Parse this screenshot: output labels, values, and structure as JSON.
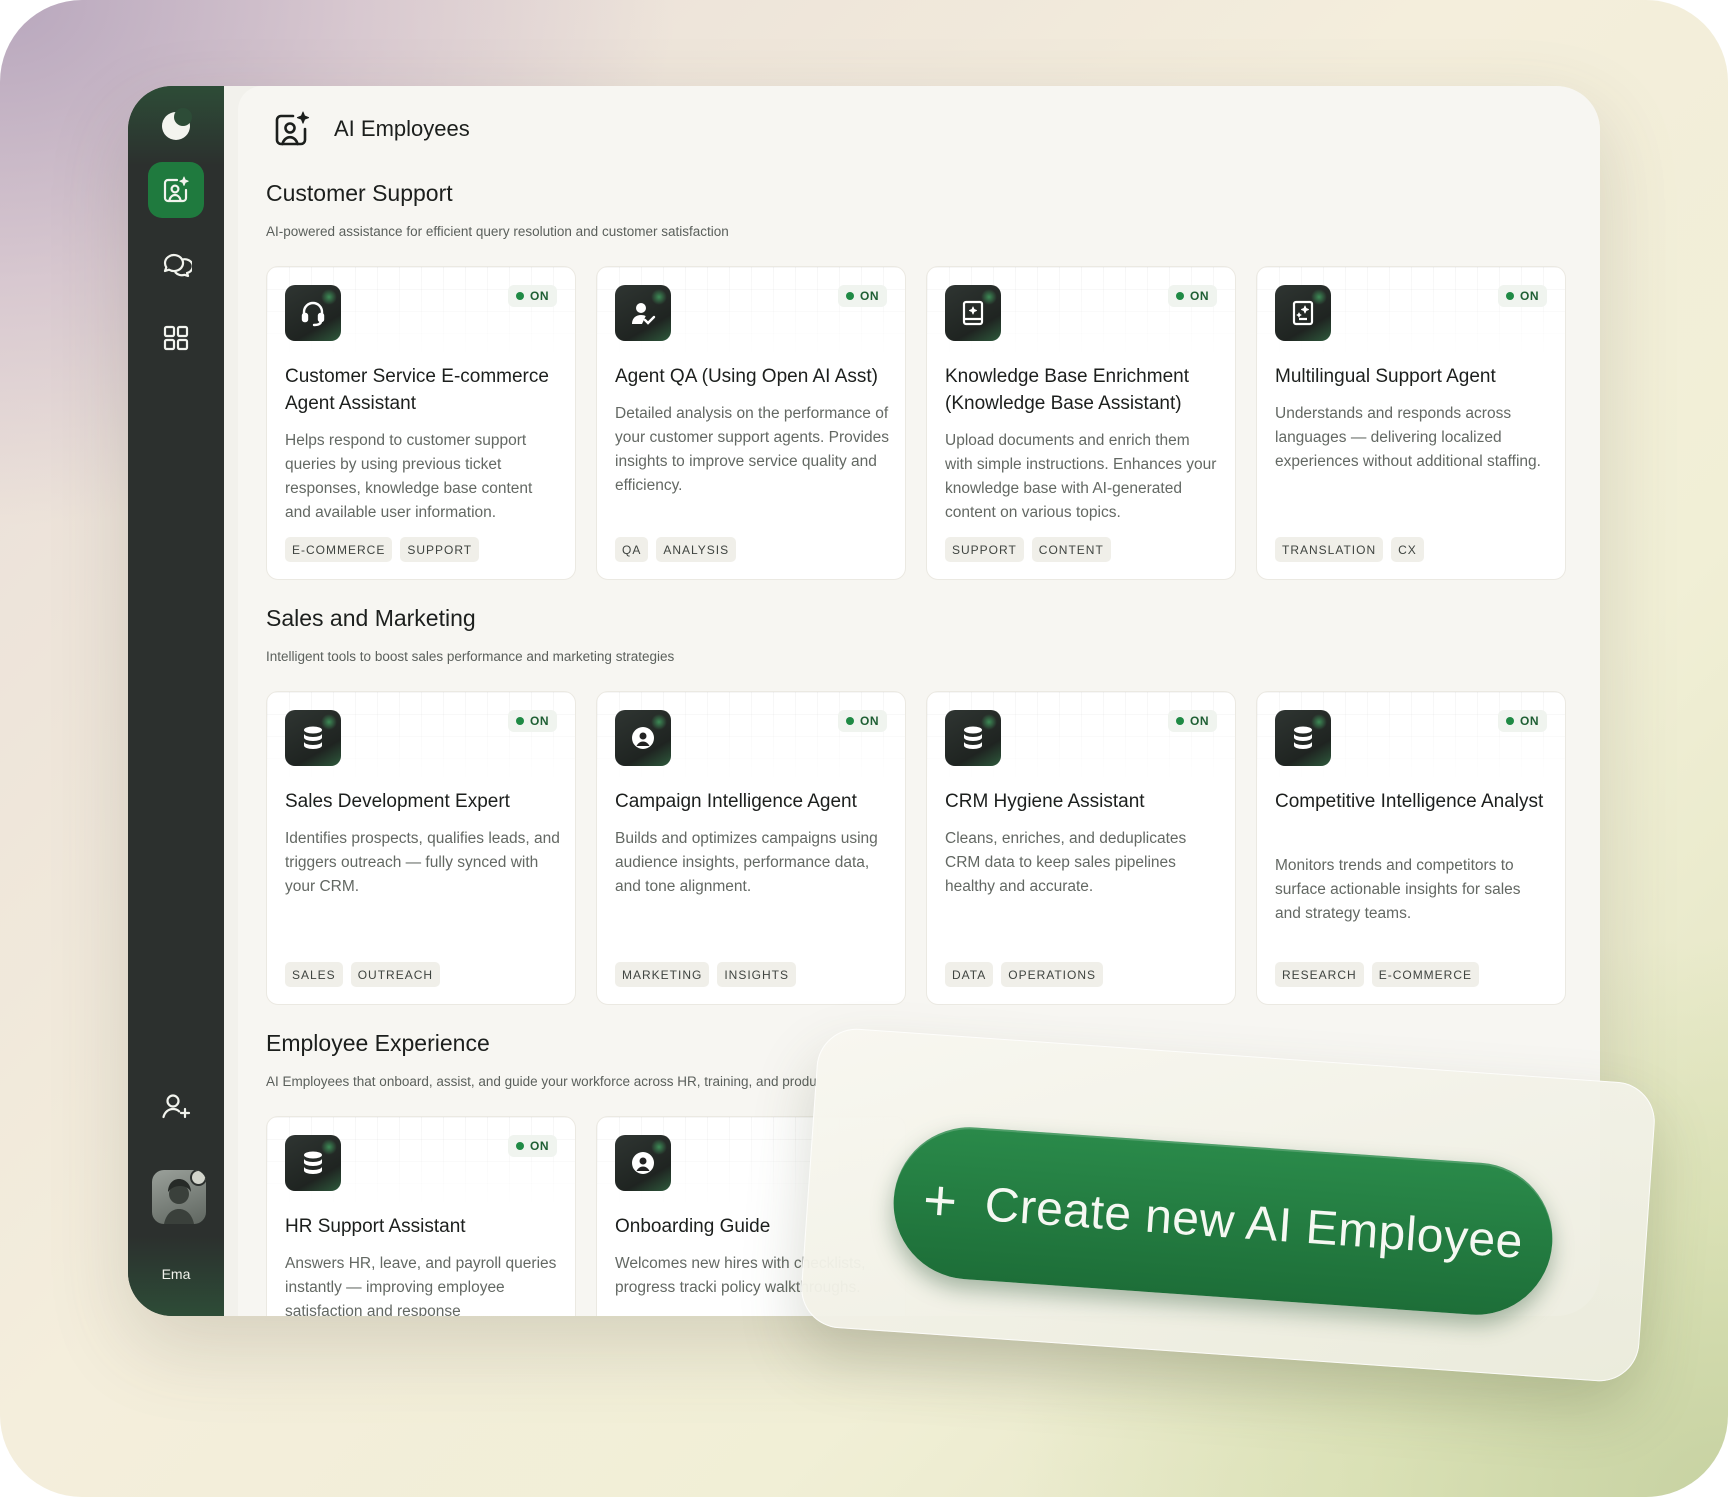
{
  "app": {
    "title": "AI Employees",
    "user_name": "Ema"
  },
  "colors": {
    "accent": "#1f7a3e",
    "sidebar": "#2c302e",
    "on_dot": "#1f8a45"
  },
  "sidebar": {
    "items": [
      {
        "name": "ai-employees",
        "icon": "user-sparkle-icon",
        "active": true
      },
      {
        "name": "chats",
        "icon": "chat-bubbles-icon",
        "active": false
      },
      {
        "name": "apps",
        "icon": "grid-icon",
        "active": false
      },
      {
        "name": "add-user",
        "icon": "user-plus-icon",
        "active": false
      }
    ]
  },
  "sections": [
    {
      "title": "Customer Support",
      "subtitle": "AI-powered assistance for efficient query resolution and customer satisfaction",
      "cards": [
        {
          "title": "Customer Service E-commerce Agent Assistant",
          "status": "ON",
          "icon": "headset-icon",
          "desc": "Helps respond to customer support queries by using previous ticket responses, knowledge base content and available user information.",
          "tags": [
            "E-COMMERCE",
            "SUPPORT"
          ]
        },
        {
          "title": "Agent QA (Using Open AI Asst)",
          "status": "ON",
          "icon": "user-check-icon",
          "desc": "Detailed analysis on the performance of your customer support agents. Provides insights to improve service quality and efficiency.",
          "tags": [
            "QA",
            "ANALYSIS"
          ]
        },
        {
          "title": "Knowledge Base Enrichment (Knowledge Base Assistant)",
          "status": "ON",
          "icon": "book-sparkle-icon",
          "desc": "Upload documents and enrich them with simple instructions. Enhances your knowledge base with AI-generated content on various topics.",
          "tags": [
            "SUPPORT",
            "CONTENT"
          ]
        },
        {
          "title": "Multilingual Support Agent",
          "status": "ON",
          "icon": "document-sparkle-icon",
          "desc": "Understands and responds across languages — delivering localized experiences without additional staffing.",
          "tags": [
            "TRANSLATION",
            "CX"
          ]
        }
      ]
    },
    {
      "title": "Sales and Marketing",
      "subtitle": "Intelligent tools to boost sales performance and marketing strategies",
      "cards": [
        {
          "title": "Sales Development Expert",
          "status": "ON",
          "icon": "database-icon",
          "desc": "Identifies prospects, qualifies leads, and triggers outreach — fully synced with your CRM.",
          "tags": [
            "SALES",
            "OUTREACH"
          ]
        },
        {
          "title": "Campaign Intelligence Agent",
          "status": "ON",
          "icon": "face-sparkle-icon",
          "desc": "Builds and optimizes campaigns using audience insights, performance data, and tone alignment.",
          "tags": [
            "MARKETING",
            "INSIGHTS"
          ]
        },
        {
          "title": "CRM Hygiene Assistant",
          "status": "ON",
          "icon": "database-icon",
          "desc": "Cleans, enriches, and deduplicates CRM data to keep sales pipelines healthy and accurate.",
          "tags": [
            "DATA",
            "OPERATIONS"
          ]
        },
        {
          "title": "Competitive Intelligence Analyst",
          "status": "ON",
          "icon": "database-icon",
          "desc": "Monitors trends and competitors to surface actionable insights for sales and strategy teams.",
          "tags": [
            "RESEARCH",
            "E-COMMERCE"
          ]
        }
      ]
    },
    {
      "title": "Employee Experience",
      "subtitle": "AI Employees that onboard, assist, and guide your workforce across HR, training, and produ",
      "cards": [
        {
          "title": "HR Support Assistant",
          "status": "ON",
          "icon": "database-icon",
          "desc": "Answers HR, leave, and payroll queries instantly — improving employee satisfaction and response",
          "tags": []
        },
        {
          "title": "Onboarding Guide",
          "status": "",
          "icon": "face-sparkle-icon",
          "desc": "Welcomes new hires with checklists, progress tracki policy walkthroughs.",
          "tags": []
        }
      ]
    }
  ],
  "cta": {
    "plus": "+",
    "label": "Create new AI Employee"
  }
}
